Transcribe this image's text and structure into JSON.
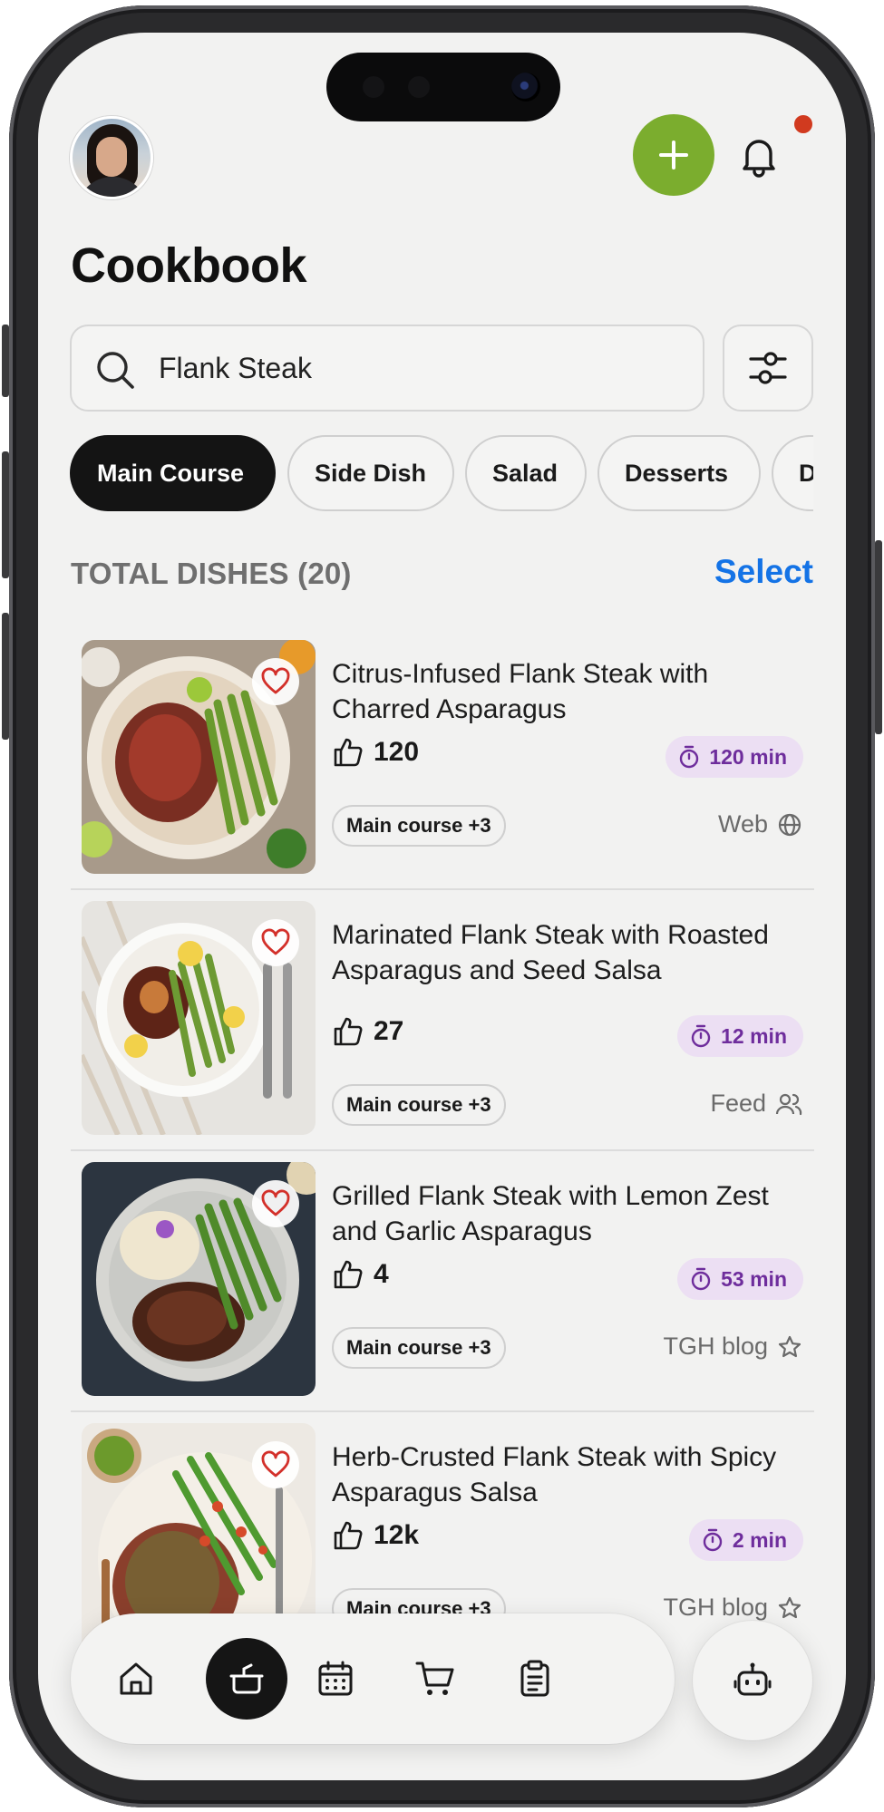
{
  "header": {
    "title": "Cookbook",
    "add_icon": "plus-icon",
    "notification_icon": "bell-icon",
    "accent_color": "#7bad2e",
    "notification_dot_color": "#d13a1f"
  },
  "search": {
    "value": "Flank Steak",
    "icon": "search-icon",
    "filter_icon": "sliders-icon"
  },
  "categories": [
    {
      "label": "Main Course",
      "active": true
    },
    {
      "label": "Side Dish",
      "active": false
    },
    {
      "label": "Salad",
      "active": false
    },
    {
      "label": "Desserts",
      "active": false
    },
    {
      "label": "Drinks",
      "active": false
    }
  ],
  "summary": {
    "total_label": "TOTAL DISHES (20)",
    "select_label": "Select",
    "select_color": "#1473e6"
  },
  "dishes": [
    {
      "name": "Citrus-Infused Flank Steak with Charred Asparagus",
      "likes": "120",
      "time": "120 min",
      "tag": "Main course +3",
      "source": "Web",
      "source_icon": "globe-icon"
    },
    {
      "name": "Marinated Flank Steak with Roasted Asparagus and Seed Salsa",
      "likes": "27",
      "time": "12 min",
      "tag": "Main course +3",
      "source": "Feed",
      "source_icon": "users-icon"
    },
    {
      "name": "Grilled Flank Steak with Lemon Zest and Garlic Asparagus",
      "likes": "4",
      "time": "53 min",
      "tag": "Main course +3",
      "source": "TGH blog",
      "source_icon": "star-icon"
    },
    {
      "name": "Herb-Crusted Flank Steak with Spicy Asparagus Salsa",
      "likes": "12k",
      "time": "2 min",
      "tag": "Main course +3",
      "source": "TGH blog",
      "source_icon": "star-icon"
    }
  ],
  "time_badge_colors": {
    "background": "#ecdff3",
    "text": "#6e2d9c"
  },
  "nav": {
    "items": [
      {
        "icon": "home-icon",
        "active": false
      },
      {
        "icon": "pot-icon",
        "active": true
      },
      {
        "icon": "calendar-icon",
        "active": false
      },
      {
        "icon": "cart-icon",
        "active": false
      },
      {
        "icon": "clipboard-icon",
        "active": false
      }
    ],
    "assistant_icon": "robot-icon"
  }
}
